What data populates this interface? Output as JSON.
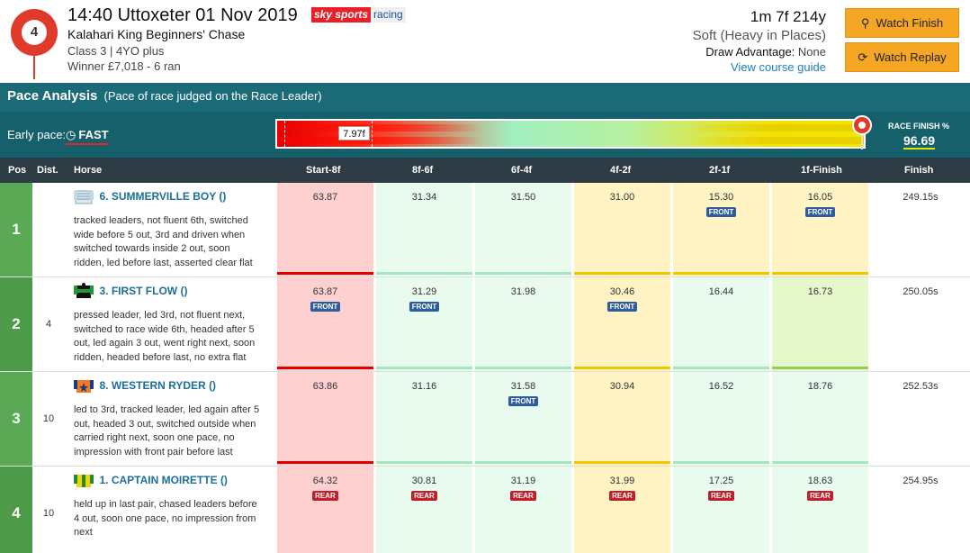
{
  "race": {
    "number": "4",
    "title": "14:40 Uttoxeter 01 Nov 2019",
    "name": "Kalahari King Beginners' Chase",
    "class_info": "Class 3 | 4YO plus",
    "winner_info": "Winner £7,018 - 6 ran",
    "distance": "1m 7f 214y",
    "going": "Soft (Heavy in Places)",
    "draw_label": "Draw Advantage:",
    "draw_value": "None",
    "course_guide": "View course guide"
  },
  "brand": {
    "sky": "sky sports",
    "racing": "racing"
  },
  "buttons": {
    "watch_finish": "Watch Finish",
    "watch_replay": "Watch Replay"
  },
  "pace": {
    "title": "Pace Analysis",
    "subtitle": "(Pace of race judged on the Race Leader)",
    "early_label": "Early pace:",
    "early_value": "FAST",
    "marker_value": "7.97f",
    "finish_label": "RACE FINISH %",
    "finish_value": "96.69"
  },
  "columns": {
    "pos": "Pos",
    "dist": "Dist.",
    "horse": "Horse",
    "s1": "Start-8f",
    "s2": "8f-6f",
    "s3": "6f-4f",
    "s4": "4f-2f",
    "s5": "2f-1f",
    "s6": "1f-Finish",
    "finish": "Finish"
  },
  "tags": {
    "front": "FRONT",
    "rear": "REAR"
  },
  "rows": [
    {
      "pos": "1",
      "dist": "",
      "number": "6.",
      "name": "SUMMERVILLE BOY",
      "suffix": "()",
      "comment": "tracked leaders, not fluent 6th, switched wide before 5 out, 3rd and driven when switched towards inside 2 out, soon ridden, led before last, asserted clear flat",
      "s1": "63.87",
      "s2": "31.34",
      "s3": "31.50",
      "s4": "31.00",
      "s5": "15.30",
      "s6": "16.05",
      "finish": "249.15s"
    },
    {
      "pos": "2",
      "dist": "4",
      "number": "3.",
      "name": "FIRST FLOW",
      "suffix": "()",
      "comment": "pressed leader, led 3rd, not fluent next, switched to race wide 6th, headed after 5 out, led again 3 out, went right next, soon ridden, headed before last, no extra flat",
      "s1": "63.87",
      "s2": "31.29",
      "s3": "31.98",
      "s4": "30.46",
      "s5": "16.44",
      "s6": "16.73",
      "finish": "250.05s"
    },
    {
      "pos": "3",
      "dist": "10",
      "number": "8.",
      "name": "WESTERN RYDER",
      "suffix": "()",
      "comment": "led to 3rd, tracked leader, led again after 5 out, headed 3 out, switched outside when carried right next, soon one pace, no impression with front pair before last",
      "s1": "63.86",
      "s2": "31.16",
      "s3": "31.58",
      "s4": "30.94",
      "s5": "16.52",
      "s6": "18.76",
      "finish": "252.53s"
    },
    {
      "pos": "4",
      "dist": "10",
      "number": "1.",
      "name": "CAPTAIN MOIRETTE",
      "suffix": "()",
      "comment": "held up in last pair, chased leaders before 4 out, soon one pace, no impression from next",
      "s1": "64.32",
      "s2": "30.81",
      "s3": "31.19",
      "s4": "31.99",
      "s5": "17.25",
      "s6": "18.63",
      "finish": "254.95s"
    }
  ]
}
